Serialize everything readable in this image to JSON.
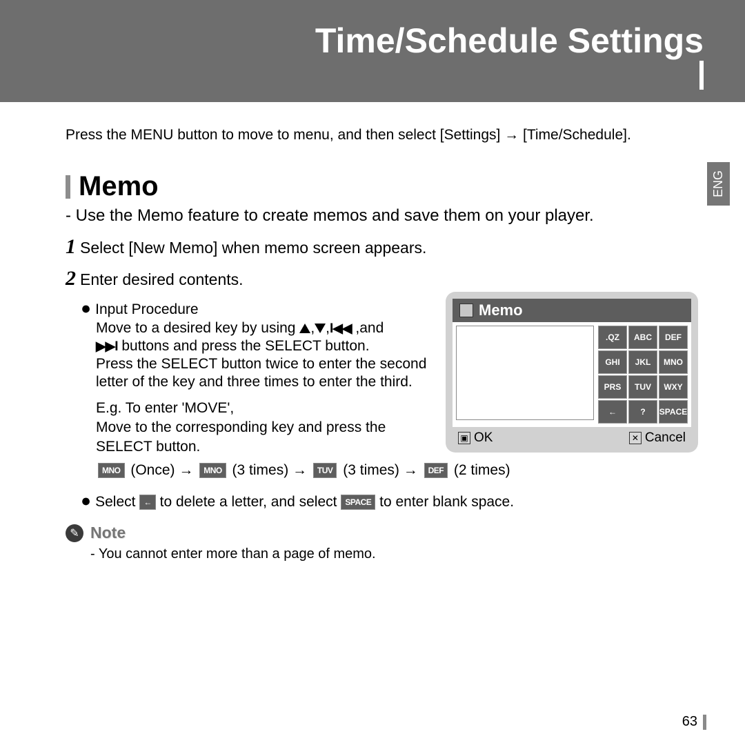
{
  "header": {
    "title": "Time/Schedule Settings"
  },
  "lang": "ENG",
  "intro": "Press the MENU button to move to menu, and then select [Settings] → [Time/Schedule].",
  "section": {
    "title": "Memo"
  },
  "sub": "- Use the Memo feature to create memos and save them on your player.",
  "step1": "Select [New Memo] when memo screen appears.",
  "step2": "Enter desired contents.",
  "bullet1": "Input Procedure",
  "move1a": "Move to a desired key by using ",
  "move1b": ",and",
  "move2": "     buttons and press the SELECT button.",
  "move3": "Press the SELECT button twice to enter the second",
  "move4": "letter of the key and three times to enter the third.",
  "eg": "E.g. To enter 'MOVE',",
  "eg2": "Move to the corresponding key and press the",
  "eg3": "SELECT button.",
  "kr": {
    "once": "(Once) → ",
    "t3a": "(3 times)  → ",
    "t3b": "(3 times) → ",
    "t2": "(2 times)"
  },
  "sel": {
    "a": "Select   ",
    "b": "  to delete a letter, and select  ",
    "c": "  to enter blank space."
  },
  "note": {
    "label": "Note",
    "body": "- You cannot enter more than a page of memo."
  },
  "page": "63",
  "device": {
    "title": "Memo",
    "ok": "OK",
    "cancel": "Cancel",
    "keys": [
      ".QZ",
      "ABC",
      "DEF",
      "GHI",
      "JKL",
      "MNO",
      "PRS",
      "TUV",
      "WXY",
      "←",
      "?",
      "SPACE"
    ]
  },
  "ikeys": {
    "mno": "MNO",
    "tuv": "TUV",
    "def": "DEF",
    "back": "←",
    "space": "SPACE"
  }
}
